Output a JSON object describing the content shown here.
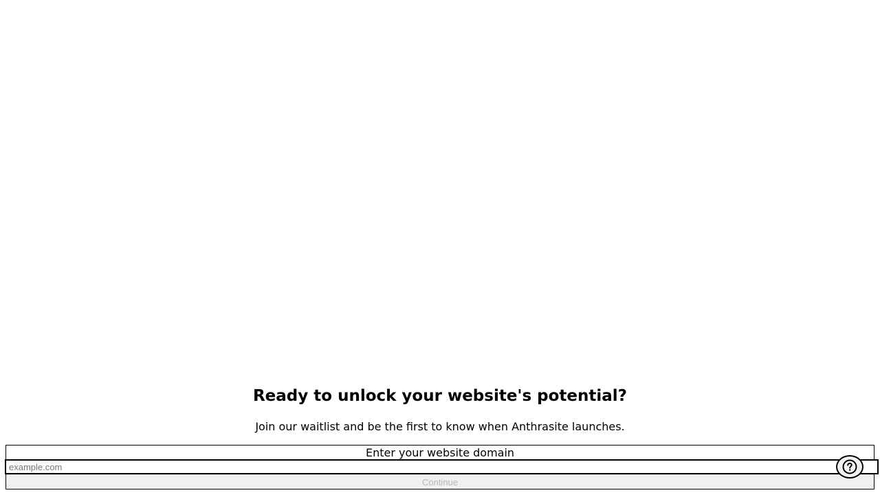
{
  "cta": {
    "title": "Ready to unlock your website's potential?",
    "subtitle": "Join our waitlist and be the first to know when Anthrasite launches."
  },
  "form": {
    "label": "Enter your website domain",
    "input_placeholder": "example.com",
    "input_value": "",
    "continue_label": "Continue",
    "continue_disabled": true
  },
  "help": {
    "icon": "question-circle-icon"
  }
}
